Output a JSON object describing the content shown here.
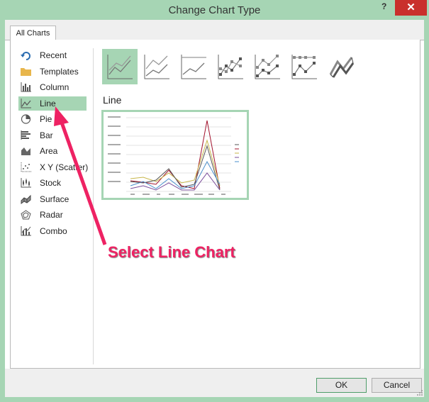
{
  "window": {
    "title": "Change Chart Type",
    "help_label": "?",
    "close_label": "✕"
  },
  "tabs": [
    {
      "label": "All Charts"
    }
  ],
  "categories": [
    {
      "label": "Recent",
      "icon": "recent-icon"
    },
    {
      "label": "Templates",
      "icon": "folder-icon"
    },
    {
      "label": "Column",
      "icon": "column-chart-icon"
    },
    {
      "label": "Line",
      "icon": "line-chart-icon",
      "selected": true
    },
    {
      "label": "Pie",
      "icon": "pie-chart-icon"
    },
    {
      "label": "Bar",
      "icon": "bar-chart-icon"
    },
    {
      "label": "Area",
      "icon": "area-chart-icon"
    },
    {
      "label": "X Y (Scatter)",
      "icon": "scatter-chart-icon"
    },
    {
      "label": "Stock",
      "icon": "stock-chart-icon"
    },
    {
      "label": "Surface",
      "icon": "surface-chart-icon"
    },
    {
      "label": "Radar",
      "icon": "radar-chart-icon"
    },
    {
      "label": "Combo",
      "icon": "combo-chart-icon"
    }
  ],
  "subtypes": [
    {
      "icon": "line-icon",
      "selected": true
    },
    {
      "icon": "stacked-line-icon"
    },
    {
      "icon": "100-stacked-line-icon"
    },
    {
      "icon": "line-with-markers-icon"
    },
    {
      "icon": "stacked-line-with-markers-icon"
    },
    {
      "icon": "100-stacked-line-with-markers-icon"
    },
    {
      "icon": "3d-line-icon"
    }
  ],
  "section": {
    "title": "Line"
  },
  "annotation": {
    "label": "Select Line Chart",
    "color": "#ee2263"
  },
  "buttons": {
    "ok": "OK",
    "cancel": "Cancel"
  },
  "colors": {
    "accent": "#a6d5b4",
    "close": "#c9302c"
  }
}
